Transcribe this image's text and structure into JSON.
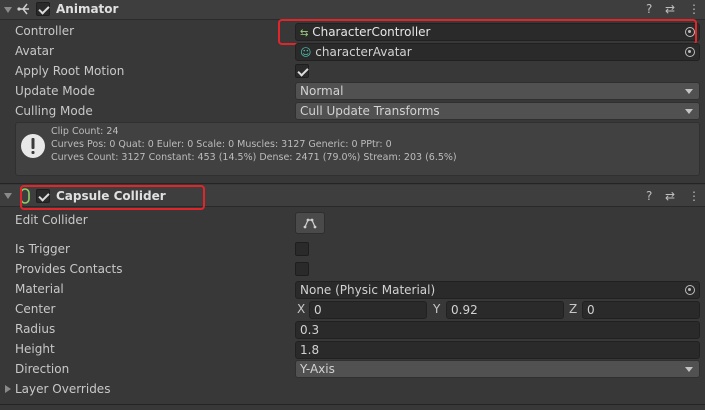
{
  "animator": {
    "title": "Animator",
    "enabled": true,
    "controller_label": "Controller",
    "controller_value": "CharacterController",
    "avatar_label": "Avatar",
    "avatar_value": "characterAvatar",
    "apply_root_motion_label": "Apply Root Motion",
    "apply_root_motion": true,
    "update_mode_label": "Update Mode",
    "update_mode_value": "Normal",
    "culling_mode_label": "Culling Mode",
    "culling_mode_value": "Cull Update Transforms",
    "info": {
      "line1": "Clip Count: 24",
      "line2": "Curves Pos: 0 Quat: 0 Euler: 0 Scale: 0 Muscles: 3127 Generic: 0 PPtr: 0",
      "line3": "Curves Count: 3127 Constant: 453 (14.5%) Dense: 2471 (79.0%) Stream: 203 (6.5%)"
    }
  },
  "capsule": {
    "title": "Capsule Collider",
    "enabled": true,
    "edit_collider_label": "Edit Collider",
    "is_trigger_label": "Is Trigger",
    "is_trigger": false,
    "provides_contacts_label": "Provides Contacts",
    "provides_contacts": false,
    "material_label": "Material",
    "material_value": "None (Physic Material)",
    "center_label": "Center",
    "center": {
      "x_label": "X",
      "x": "0",
      "y_label": "Y",
      "y": "0.92",
      "z_label": "Z",
      "z": "0"
    },
    "radius_label": "Radius",
    "radius": "0.3",
    "height_label": "Height",
    "height": "1.8",
    "direction_label": "Direction",
    "direction_value": "Y-Axis",
    "layer_overrides_label": "Layer Overrides"
  },
  "header_icons": {
    "help": "?",
    "presets": "⇄",
    "menu": "⋮"
  },
  "colors": {
    "highlight_box": "#e0262a",
    "panel_bg": "#383838",
    "header_bg": "#3e3e3e"
  }
}
